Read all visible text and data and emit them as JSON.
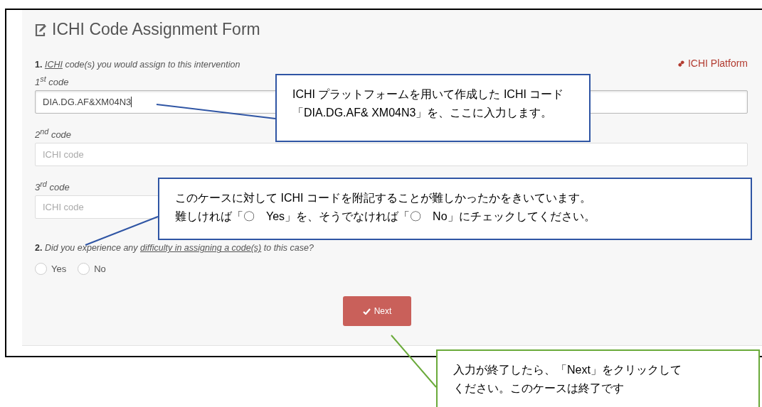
{
  "form": {
    "title": "ICHI Code Assignment Form",
    "platform_link": "ICHI Platform",
    "question_1": {
      "number": "1.",
      "link": "ICHI",
      "text": " code(s) you would assign to this intervention"
    },
    "codes": [
      {
        "label": "1$^{st}$ code",
        "value": "DIA.DG.AF&XM04N3",
        "focused": true
      },
      {
        "label": "2$^{nd}$ code",
        "placeholder": "ICHI code",
        "focused": false
      },
      {
        "label": "3$^{rd}$ code",
        "placeholder": "ICHI code",
        "focused": false
      }
    ],
    "question_2": {
      "number": "2.",
      "before": "Did you experience any ",
      "link": "difficulty in assigning a code(s)",
      "after": " to this case?"
    },
    "options": [
      {
        "label": "Yes",
        "selected": false
      },
      {
        "label": "No",
        "selected": false
      }
    ],
    "next_button": "Next"
  },
  "callouts": [
    {
      "kind": "blue",
      "lines": [
        "ICHI プラットフォームを用いて作成した ICHI コード",
        "「DIA.DG.AF& XM04N3」を、ここに入力します。"
      ]
    },
    {
      "kind": "blue",
      "lines": [
        "このケースに対して ICHI コードを附記することが難しかったかをきいています。",
        "難しければ「〇　Yes」を、そうでなければ「〇　No」にチェックしてください。"
      ]
    },
    {
      "kind": "green",
      "lines": [
        "入力が終了したら、「Next」をクリックして",
        "ください。このケースは終了です"
      ]
    }
  ]
}
